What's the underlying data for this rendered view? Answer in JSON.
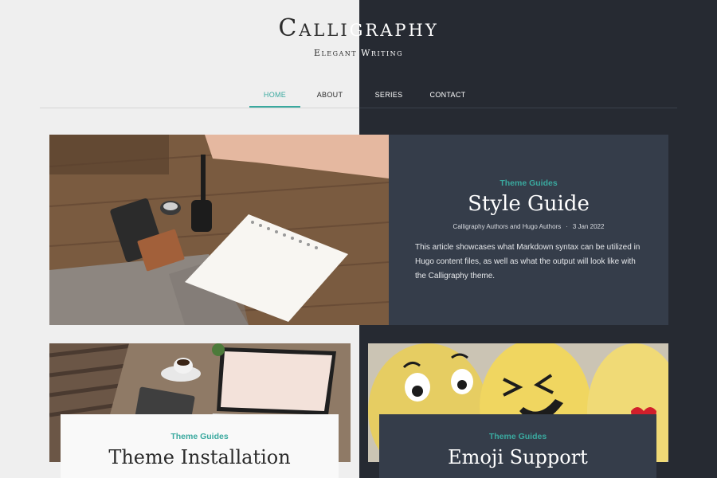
{
  "site": {
    "title_left": "Calli",
    "title_right": "graphy",
    "subtitle_left": "Elegant ",
    "subtitle_right": "Writing"
  },
  "nav": {
    "items": [
      {
        "label": "HOME"
      },
      {
        "label": "ABOUT"
      },
      {
        "label": "SERIES"
      },
      {
        "label": "CONTACT"
      }
    ],
    "active": "HOME"
  },
  "featured": {
    "category": "Theme Guides",
    "title": "Style Guide",
    "authors": "Calligraphy Authors and Hugo Authors",
    "separator": "·",
    "date": "3 Jan 2022",
    "excerpt": "This article showcases what Markdown syntax can be utilized in Hugo content files, as well as what the output will look like with the Calligraphy theme."
  },
  "cards": [
    {
      "category": "Theme Guides",
      "title": "Theme Installation"
    },
    {
      "category": "Theme Guides",
      "title": "Emoji Support"
    }
  ],
  "colors": {
    "accent": "#3aa99f",
    "light_bg": "#efefef",
    "dark_bg": "#262a32",
    "panel_dark": "#353d4a",
    "panel_light": "#f9f9f9"
  }
}
